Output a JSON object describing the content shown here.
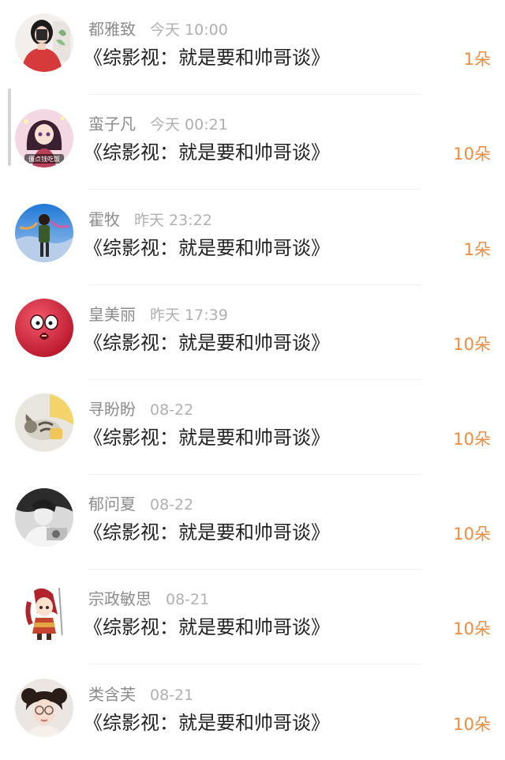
{
  "records": [
    {
      "name": "都雅致",
      "time": "今天 10:00",
      "title": "《综影视：就是要和帅哥谈》",
      "gift": "1朵",
      "avatar_icon": "girl-red-shirt-avatar-icon"
    },
    {
      "name": "蛮子凡",
      "time": "今天 00:21",
      "title": "《综影视：就是要和帅哥谈》",
      "gift": "10朵",
      "avatar_icon": "anime-girl-avatar-icon",
      "avatar_caption": "僵点钱吃饭"
    },
    {
      "name": "霍牧",
      "time": "昨天 23:22",
      "title": "《综影视：就是要和帅哥谈》",
      "gift": "1朵",
      "avatar_icon": "person-blue-sky-avatar-icon"
    },
    {
      "name": "皇美丽",
      "time": "昨天 17:39",
      "title": "《综影视：就是要和帅哥谈》",
      "gift": "10朵",
      "avatar_icon": "red-ball-face-avatar-icon"
    },
    {
      "name": "寻盼盼",
      "time": "08-22",
      "title": "《综影视：就是要和帅哥谈》",
      "gift": "10朵",
      "avatar_icon": "cat-avatar-icon"
    },
    {
      "name": "郁问夏",
      "time": "08-22",
      "title": "《综影视：就是要和帅哥谈》",
      "gift": "10朵",
      "avatar_icon": "monochrome-girl-avatar-icon"
    },
    {
      "name": "宗政敏思",
      "time": "08-21",
      "title": "《综影视：就是要和帅哥谈》",
      "gift": "10朵",
      "avatar_icon": "cartoon-warrior-avatar-icon"
    },
    {
      "name": "类含芙",
      "time": "08-21",
      "title": "《综影视：就是要和帅哥谈》",
      "gift": "10朵",
      "avatar_icon": "girl-glasses-avatar-icon"
    }
  ],
  "colors": {
    "name": "#8c8c8c",
    "time": "#b0b0b0",
    "title": "#222222",
    "gift": "#f28a3c",
    "divider": "#f0f0f0"
  }
}
